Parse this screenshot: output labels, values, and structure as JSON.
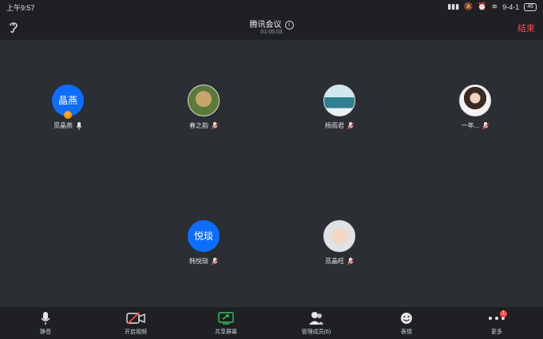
{
  "status": {
    "time": "上午9:57",
    "network": "9-4-1",
    "battery": "46"
  },
  "header": {
    "title": "腾讯会议",
    "duration": "01:05:03",
    "end_label": "结束"
  },
  "participants": [
    {
      "name": "觅晶燕",
      "avatar_text": "晶燕",
      "avatar_type": "text",
      "host": true,
      "mic": "on"
    },
    {
      "name": "春之韵",
      "avatar_type": "photo",
      "mic": "muted"
    },
    {
      "name": "杨雨君",
      "avatar_type": "photo",
      "mic": "muted"
    },
    {
      "name": "一年...",
      "avatar_type": "photo",
      "mic": "muted"
    },
    {
      "name": "韩悦琰",
      "avatar_text": "悦琰",
      "avatar_type": "text",
      "mic": "muted"
    },
    {
      "name": "觅晶旺",
      "avatar_type": "photo",
      "mic": "muted"
    }
  ],
  "toolbar": {
    "mute_label": "静音",
    "video_label": "开启视频",
    "share_label": "共享屏幕",
    "manage_label": "管理成员(6)",
    "emoji_label": "表情",
    "more_label": "更多",
    "more_badge": "1"
  },
  "colors": {
    "accent_blue": "#0d6efd",
    "end_red": "#ff4b4b",
    "muted_red": "#ff4b4b"
  }
}
